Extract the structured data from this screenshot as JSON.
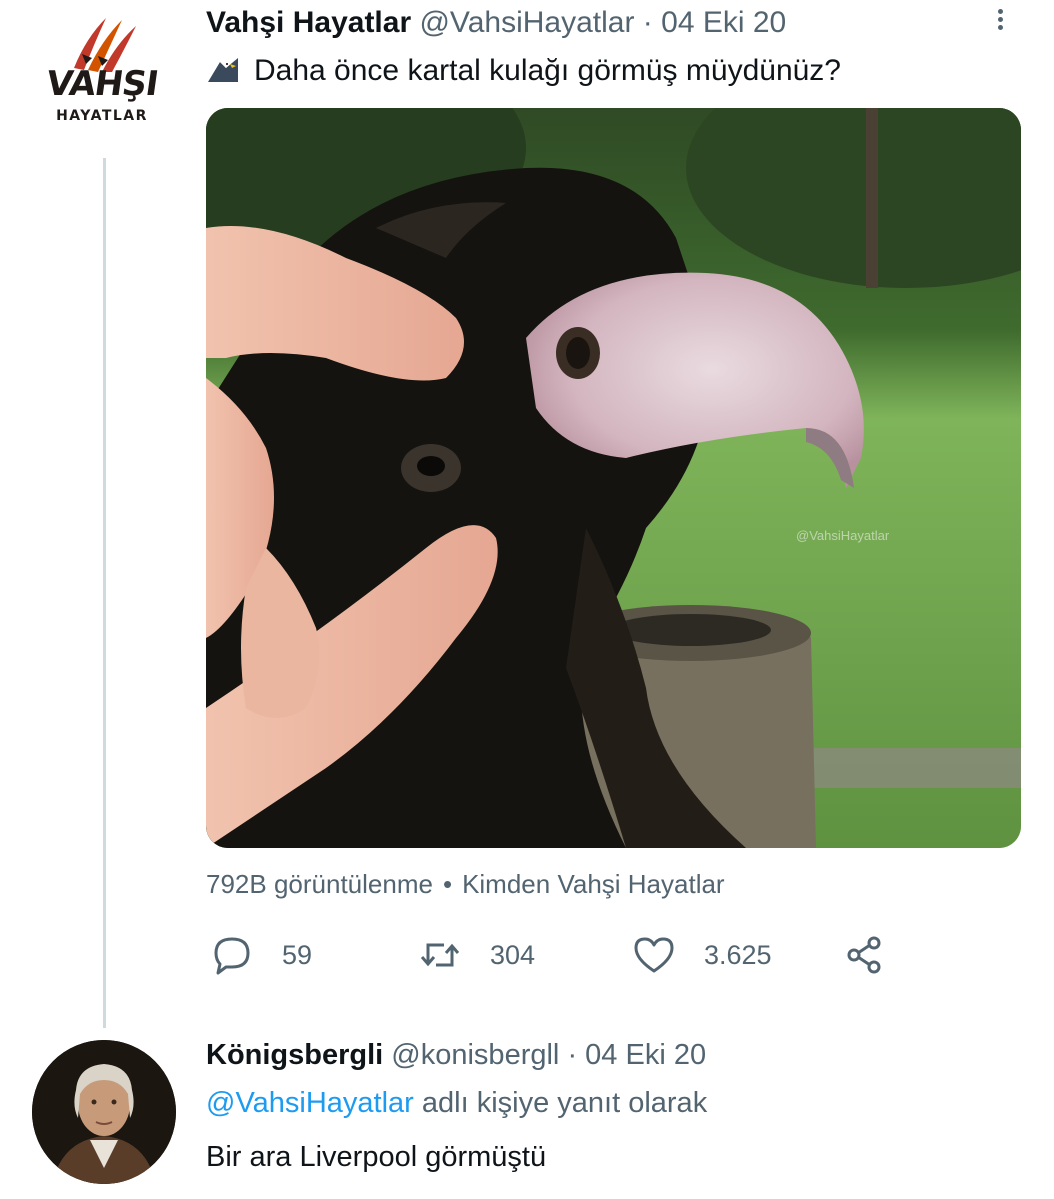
{
  "tweet": {
    "logo": {
      "word": "VAHŞI",
      "sub": "HAYATLAR",
      "color": "#c0392b"
    },
    "author_name": "Vahşi Hayatlar",
    "handle": "@VahsiHayatlar",
    "separator": "·",
    "date": "04 Eki 20",
    "emoji": "eagle-emoji",
    "text": "Daha önce kartal kulağı görmüş müydünüz?",
    "media": {
      "watermark": "@VahsiHayatlar"
    },
    "views_label": "792B görüntülenme",
    "views_dot": "•",
    "source_label": "Kimden Vahşi Hayatlar",
    "actions": {
      "replies": "59",
      "retweets": "304",
      "likes": "3.625"
    }
  },
  "reply": {
    "author_name": "Königsbergli",
    "handle": "@konisbergll",
    "separator": "·",
    "date": "04 Eki 20",
    "mention": "@VahsiHayatlar",
    "reply_suffix": "adlı kişiye yanıt olarak",
    "text": "Bir ara Liverpool görmüştü"
  },
  "colors": {
    "link": "#1d9bf0",
    "muted": "#536471",
    "thread_line": "#cfd9de"
  }
}
